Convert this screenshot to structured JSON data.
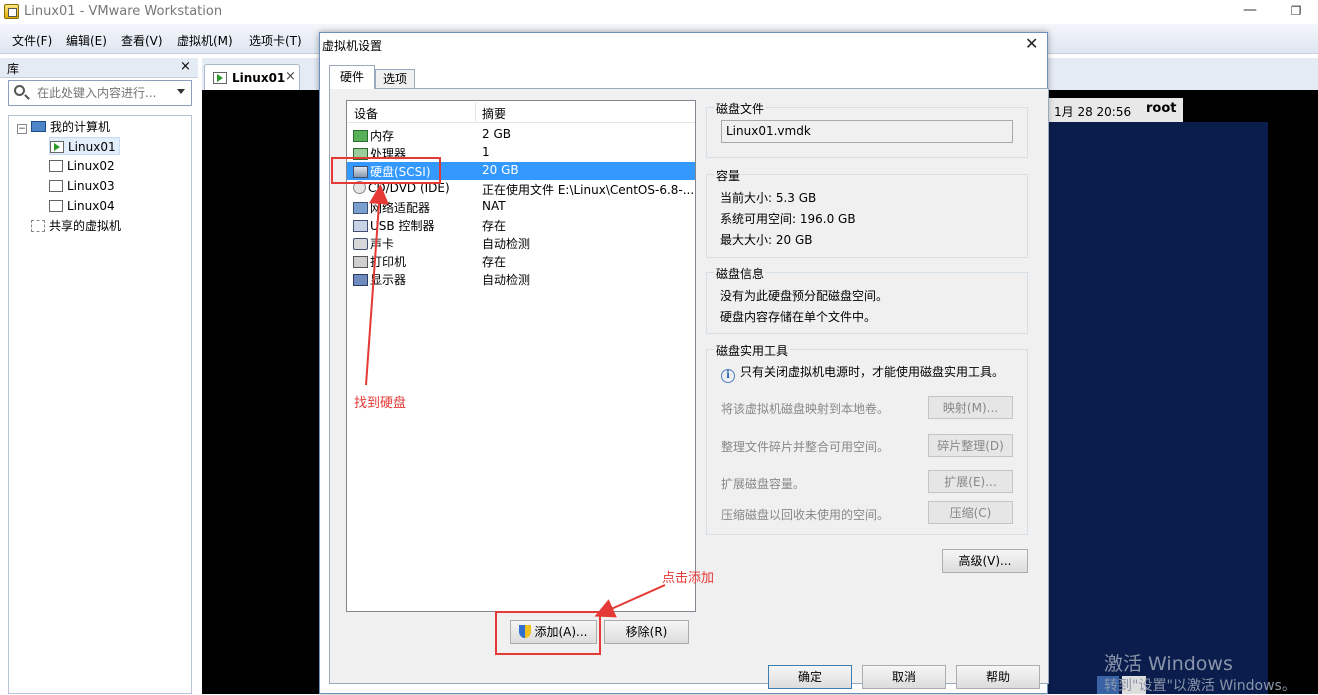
{
  "window": {
    "title": "Linux01 - VMware Workstation",
    "minimize": "—",
    "restore": "❐"
  },
  "menu": {
    "file": "文件(F)",
    "edit": "编辑(E)",
    "view": "查看(V)",
    "vm": "虚拟机(M)",
    "tabs": "选项卡(T)"
  },
  "library": {
    "title": "库",
    "close": "×",
    "search_placeholder": "在此处键入内容进行...",
    "tree": {
      "root": "我的计算机",
      "vms": [
        "Linux01",
        "Linux02",
        "Linux03",
        "Linux04"
      ],
      "shared": "共享的虚拟机"
    }
  },
  "vm_tab": {
    "label": "Linux01",
    "close": "×"
  },
  "guest": {
    "clock": "1月 28 20:56",
    "user": "root"
  },
  "watermark": {
    "line1": "激活 Windows",
    "line2": "转到\"设置\"以激活 Windows。"
  },
  "dialog": {
    "title": "虚拟机设置",
    "close": "✕",
    "tabs": {
      "hardware": "硬件",
      "options": "选项"
    },
    "columns": {
      "device": "设备",
      "summary": "摘要"
    },
    "devices": [
      {
        "name": "内存",
        "summary": "2 GB",
        "icon": "memory-icon"
      },
      {
        "name": "处理器",
        "summary": "1",
        "icon": "cpu-icon"
      },
      {
        "name": "硬盘(SCSI)",
        "summary": "20 GB",
        "icon": "harddisk-icon"
      },
      {
        "name": "CD/DVD (IDE)",
        "summary": "正在使用文件 E:\\Linux\\CentOS-6.8-...",
        "icon": "cdrom-icon"
      },
      {
        "name": "网络适配器",
        "summary": "NAT",
        "icon": "network-icon"
      },
      {
        "name": "USB 控制器",
        "summary": "存在",
        "icon": "usb-icon"
      },
      {
        "name": "声卡",
        "summary": "自动检测",
        "icon": "sound-icon"
      },
      {
        "name": "打印机",
        "summary": "存在",
        "icon": "printer-icon"
      },
      {
        "name": "显示器",
        "summary": "自动检测",
        "icon": "display-icon"
      }
    ],
    "add_button": "添加(A)...",
    "remove_button": "移除(R)",
    "disk_file": {
      "title": "磁盘文件",
      "value": "Linux01.vmdk"
    },
    "capacity": {
      "title": "容量",
      "current": "当前大小: 5.3 GB",
      "available": "系统可用空间: 196.0 GB",
      "max": "最大大小: 20 GB"
    },
    "disk_info": {
      "title": "磁盘信息",
      "line1": "没有为此硬盘预分配磁盘空间。",
      "line2": "硬盘内容存储在单个文件中。"
    },
    "utilities": {
      "title": "磁盘实用工具",
      "note": "只有关闭虚拟机电源时，才能使用磁盘实用工具。",
      "map_text": "将该虚拟机磁盘映射到本地卷。",
      "map_button": "映射(M)...",
      "defrag_text": "整理文件碎片并整合可用空间。",
      "defrag_button": "碎片整理(D)",
      "expand_text": "扩展磁盘容量。",
      "expand_button": "扩展(E)...",
      "compact_text": "压缩磁盘以回收未使用的空间。",
      "compact_button": "压缩(C)"
    },
    "advanced_button": "高级(V)...",
    "ok_button": "确定",
    "cancel_button": "取消",
    "help_button": "帮助"
  },
  "annotations": {
    "find_disk": "找到硬盘",
    "click_add": "点击添加"
  },
  "colors": {
    "accent": "#3399ff",
    "annotation": "#e53935",
    "guest_bg": "#0b1d4d"
  }
}
